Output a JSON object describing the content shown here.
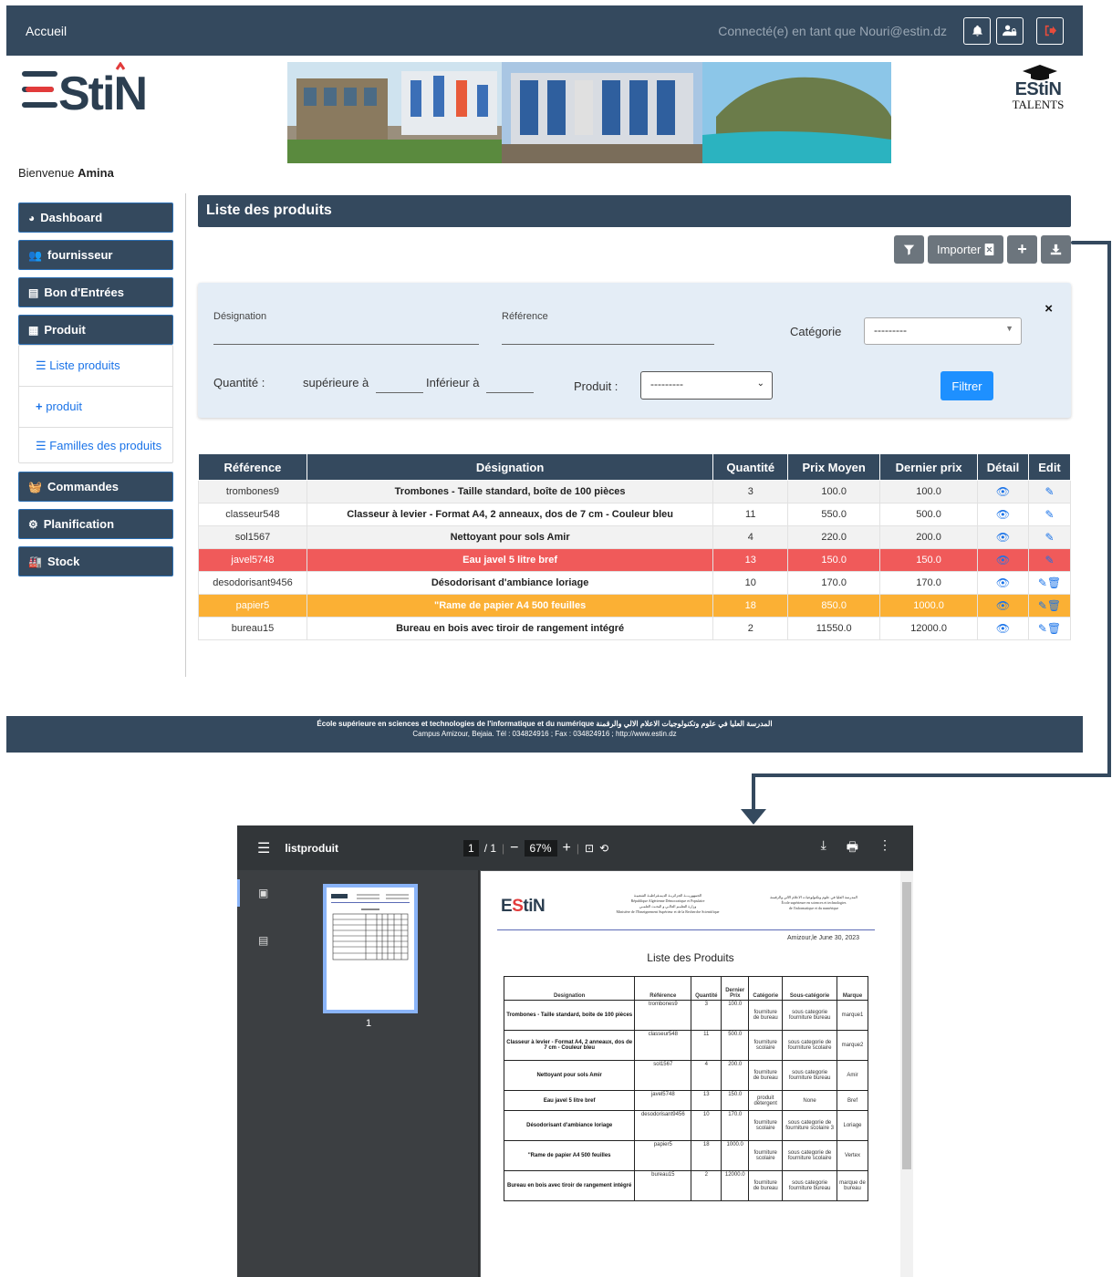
{
  "topbar": {
    "home": "Accueil",
    "connected_as": "Connecté(e) en tant que Nouri@estin.dz"
  },
  "header": {
    "logo_text": "EStiN",
    "talents_logo": "EStiN",
    "talents_label": "TALENTS",
    "welcome_prefix": "Bienvenue",
    "welcome_name": "Amina"
  },
  "sidebar": {
    "items": [
      {
        "label": "Dashboard",
        "icon": "pie-chart-icon"
      },
      {
        "label": "fournisseur",
        "icon": "users-icon"
      },
      {
        "label": "Bon d'Entrées",
        "icon": "file-icon"
      },
      {
        "label": "Produit",
        "icon": "boxes-icon"
      },
      {
        "label": "Commandes",
        "icon": "basket-icon"
      },
      {
        "label": "Planification",
        "icon": "gears-icon"
      },
      {
        "label": "Stock",
        "icon": "warehouse-icon"
      }
    ],
    "submenu": [
      {
        "label": "Liste produits",
        "icon": "list-icon"
      },
      {
        "label": "produit",
        "icon": "plus-icon"
      },
      {
        "label": "Familles des produits",
        "icon": "list-icon"
      }
    ]
  },
  "content": {
    "title": "Liste des produits",
    "import_label": "Importer",
    "filter": {
      "designation_label": "Désignation",
      "reference_label": "Référence",
      "categorie_label": "Catégorie",
      "categorie_value": "---------",
      "quantite_label": "Quantité :",
      "superieure_label": "supérieure à",
      "inferieur_label": "Inférieur à",
      "produit_label": "Produit :",
      "produit_value": "---------",
      "close": "×",
      "button": "Filtrer"
    },
    "table": {
      "headers": [
        "Référence",
        "Désignation",
        "Quantité",
        "Prix Moyen",
        "Dernier prix",
        "Détail",
        "Edit"
      ],
      "rows": [
        {
          "ref": "trombones9",
          "des": "Trombones - Taille standard, boîte de 100 pièces",
          "qte": "3",
          "moy": "100.0",
          "der": "100.0",
          "status": "normal"
        },
        {
          "ref": "classeur548",
          "des": "Classeur à levier - Format A4, 2 anneaux, dos de 7 cm - Couleur bleu",
          "qte": "11",
          "moy": "550.0",
          "der": "500.0",
          "status": "normal"
        },
        {
          "ref": "sol1567",
          "des": "Nettoyant pour sols Amir",
          "qte": "4",
          "moy": "220.0",
          "der": "200.0",
          "status": "normal"
        },
        {
          "ref": "javel5748",
          "des": "Eau javel 5 litre bref",
          "qte": "13",
          "moy": "150.0",
          "der": "150.0",
          "status": "red"
        },
        {
          "ref": "desodorisant9456",
          "des": "Désodorisant d'ambiance loriage",
          "qte": "10",
          "moy": "170.0",
          "der": "170.0",
          "status": "normal"
        },
        {
          "ref": "papier5",
          "des": "\"Rame de papier A4 500 feuilles",
          "qte": "18",
          "moy": "850.0",
          "der": "1000.0",
          "status": "orange"
        },
        {
          "ref": "bureau15",
          "des": "Bureau en bois avec tiroir de rangement intégré",
          "qte": "2",
          "moy": "11550.0",
          "der": "12000.0",
          "status": "normal"
        }
      ]
    }
  },
  "footer": {
    "line1_fr": "École supérieure en sciences et technologies de l'informatique et du numérique",
    "line1_ar": "المدرسة العليا في علوم وتكنولوجيات الاعلام الالي والرقمنة",
    "line2": "Campus Amizour, Bejaia. Tél : 034824916 ; Fax : 034824916 ; http://www.estin.dz"
  },
  "pdf_viewer": {
    "filename": "listproduit",
    "page_current": "1",
    "page_total": "/ 1",
    "zoom": "67%",
    "thumb_number": "1",
    "doc": {
      "header_center": [
        "الجمهوريـــة الجزائريـة الديمـقراطيـة الشعبيـة",
        "République Algérienne Démocratique et Populaire",
        "وزارة التعليـم العالـي و البحـث العلمـي",
        "Ministère de l'Enseignement Supérieur et de la Recherche Scientifique"
      ],
      "header_right": [
        "المدرسة العليا في علوم وتكنولوجيات الاعلام الالي والرقمنة",
        "École supérieure en sciences et technologies",
        "de l'informatique et du numérique"
      ],
      "date": "Amizour,le June 30, 2023",
      "title": "Liste des Produits",
      "headers": [
        "Designation",
        "Référence",
        "Quantité",
        "Dernier Prix",
        "Catégorie",
        "Sous-catégorie",
        "Marque"
      ],
      "rows": [
        {
          "des": "Trombones - Taille standard, boîte de 100 pièces",
          "ref": "trombones9",
          "qte": "3",
          "prix": "100.0",
          "cat": "fourniture de bureau",
          "sous": "sous categorie fourniture bureau",
          "marque": "marque1"
        },
        {
          "des": "Classeur à levier - Format A4, 2 anneaux, dos de 7 cm - Couleur bleu",
          "ref": "classeur548",
          "qte": "11",
          "prix": "500.0",
          "cat": "fourniture scolaire",
          "sous": "sous categorie de fourniture scolaire",
          "marque": "marque2"
        },
        {
          "des": "Nettoyant pour sols Amir",
          "ref": "sol1567",
          "qte": "4",
          "prix": "200.0",
          "cat": "fourniture de bureau",
          "sous": "sous categorie fourniture bureau",
          "marque": "Amir"
        },
        {
          "des": "Eau javel 5 litre bref",
          "ref": "javel5748",
          "qte": "13",
          "prix": "150.0",
          "cat": "produit détergent",
          "sous": "None",
          "marque": "Bref"
        },
        {
          "des": "Désodorisant d'ambiance loriage",
          "ref": "desodorisant9456",
          "qte": "10",
          "prix": "170.0",
          "cat": "fourniture scolaire",
          "sous": "sous categorie de fourniture scolaire 3",
          "marque": "Loriage"
        },
        {
          "des": "\"Rame de papier A4 500 feuilles",
          "ref": "papier5",
          "qte": "18",
          "prix": "1000.0",
          "cat": "fourniture scolaire",
          "sous": "sous categorie de fourniture scolaire",
          "marque": "Vertex"
        },
        {
          "des": "Bureau en bois avec tiroir de rangement intégré",
          "ref": "bureau15",
          "qte": "2",
          "prix": "12000.0",
          "cat": "fourniture de bureau",
          "sous": "sous categorie fourniture bureau",
          "marque": "marque de bureau"
        }
      ]
    }
  },
  "colors": {
    "primary": "#34495e",
    "accent": "#1a73e8",
    "row_red": "#f05a5a",
    "row_orange": "#fbb034",
    "filter_bg": "#e4edf6"
  }
}
